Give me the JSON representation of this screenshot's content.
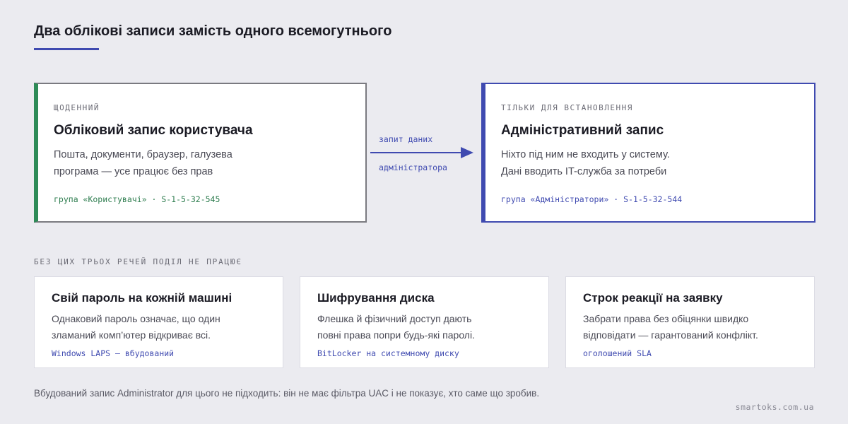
{
  "header": {
    "title": "Два облікові записи замість одного всемогутнього"
  },
  "accounts": {
    "user": {
      "kicker": "ЩОДЕННИЙ",
      "heading": "Обліковий запис користувача",
      "desc_line1": "Пошта, документи, браузер, галузева",
      "desc_line2": "програма — усе працює без прав",
      "tag": "група «Користувачі» · S-1-5-32-545"
    },
    "admin": {
      "kicker": "ТІЛЬКИ ДЛЯ ВСТАНОВЛЕННЯ",
      "heading": "Адміністративний запис",
      "desc_line1": "Ніхто під ним не входить у систему.",
      "desc_line2": "Дані вводить IT-служба за потреби",
      "tag": "група «Адміністратори» · S-1-5-32-544"
    },
    "arrow": {
      "label_top": "запит даних",
      "label_bottom": "адміністратора"
    }
  },
  "requirements": {
    "section_label": "БЕЗ ЦИХ ТРЬОХ РЕЧЕЙ ПОДІЛ НЕ ПРАЦЮЄ",
    "items": [
      {
        "heading": "Свій пароль на кожній машині",
        "desc_line1": "Однаковий пароль означає, що один",
        "desc_line2": "зламаний комп’ютер відкриває всі.",
        "tag": "Windows LAPS — вбудований"
      },
      {
        "heading": "Шифрування диска",
        "desc_line1": "Флешка й фізичний доступ дають",
        "desc_line2": "повні права попри будь-які паролі.",
        "tag": "BitLocker на системному диску"
      },
      {
        "heading": "Строк реакції на заявку",
        "desc_line1": "Забрати права без обіцянки швидко",
        "desc_line2": "відповідати — гарантований конфлікт.",
        "tag": "оголошений SLA"
      }
    ]
  },
  "footer": {
    "note": "Вбудований запис Administrator для цього не підходить: він не має фільтра UAC і не показує, хто саме що зробив.",
    "site": "smartoks.com.ua"
  },
  "colors": {
    "accent": "#3f4ab0",
    "user_green": "#2e8b57",
    "background": "#ebebf0"
  }
}
